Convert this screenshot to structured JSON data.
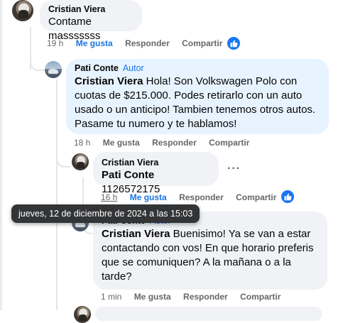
{
  "comments": [
    {
      "author": "Cristian Viera",
      "text": "Contame masssssss",
      "time": "19 h",
      "like": "Me gusta",
      "reply": "Responder",
      "share": "Compartir"
    },
    {
      "author": "Pati Conte",
      "badge": "Autor",
      "mention": "Cristian Viera",
      "text": "Hola! Son Volkswagen Polo con cuotas de $215.000. Podes retirarlo con un auto usado o un anticipo! Tambien tenemos otros autos. Pasame tu numero y te hablamos!",
      "time": "18 h",
      "like": "Me gusta",
      "reply": "Responder",
      "share": "Compartir"
    },
    {
      "author": "Cristian Viera",
      "mention": "Pati Conte",
      "text": "1126572175",
      "time": "16 h",
      "like": "Me gusta",
      "reply": "Responder",
      "share": "Compartir",
      "more": "···"
    },
    {
      "author": "Pati Conte",
      "badge": "Autor",
      "mention": "Cristian Viera",
      "text": "Buenisimo! Ya se van a estar contactando con vos! En que horario preferis que se comuniquen? A la mañana o a la tarde?",
      "time": "1 min",
      "like": "Me gusta",
      "reply": "Responder",
      "share": "Compartir"
    }
  ],
  "tooltip": "jueves, 12 de diciembre de 2024 a las 15:03",
  "colors": {
    "accent": "#1b74e4",
    "like_icon": "#1877f2",
    "bubble": "#f0f2f5",
    "author_bubble": "#e7f3ff"
  }
}
